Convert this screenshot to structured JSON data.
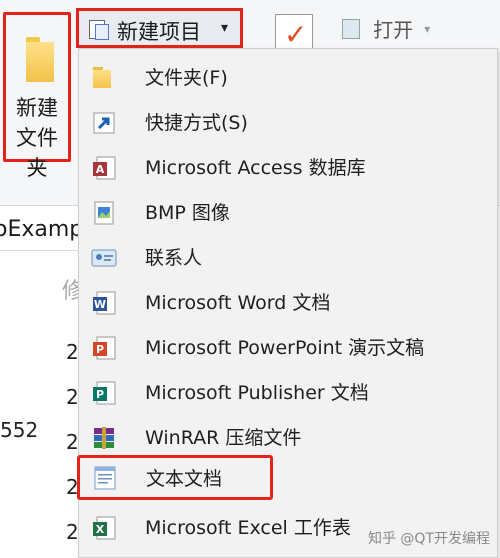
{
  "ribbon": {
    "new_folder_label": "新建\n文件夹",
    "new_item_label": "新建项目",
    "open_label": "打开"
  },
  "explorer": {
    "path_fragment": "oExamp",
    "column_fragment": "修",
    "date_prefix": "2",
    "size_fragment": "552"
  },
  "menu": {
    "items": [
      {
        "label": "文件夹(F)",
        "icon": "folder-icon"
      },
      {
        "label": "快捷方式(S)",
        "icon": "shortcut-icon"
      },
      {
        "label": "Microsoft Access 数据库",
        "icon": "access-icon"
      },
      {
        "label": "BMP 图像",
        "icon": "bmp-image-icon"
      },
      {
        "label": "联系人",
        "icon": "contact-icon"
      },
      {
        "label": "Microsoft Word 文档",
        "icon": "word-icon"
      },
      {
        "label": "Microsoft PowerPoint 演示文稿",
        "icon": "powerpoint-icon"
      },
      {
        "label": "Microsoft Publisher 文档",
        "icon": "publisher-icon"
      },
      {
        "label": "WinRAR 压缩文件",
        "icon": "winrar-icon"
      },
      {
        "label": "文本文档",
        "icon": "text-document-icon"
      },
      {
        "label": "Microsoft Excel 工作表",
        "icon": "excel-icon"
      }
    ]
  },
  "watermark": "知乎 @QT开发编程",
  "colors": {
    "highlight": "#e2231a",
    "menu_bg": "#f2f2f2",
    "ribbon_bg": "#f5f6f7"
  }
}
